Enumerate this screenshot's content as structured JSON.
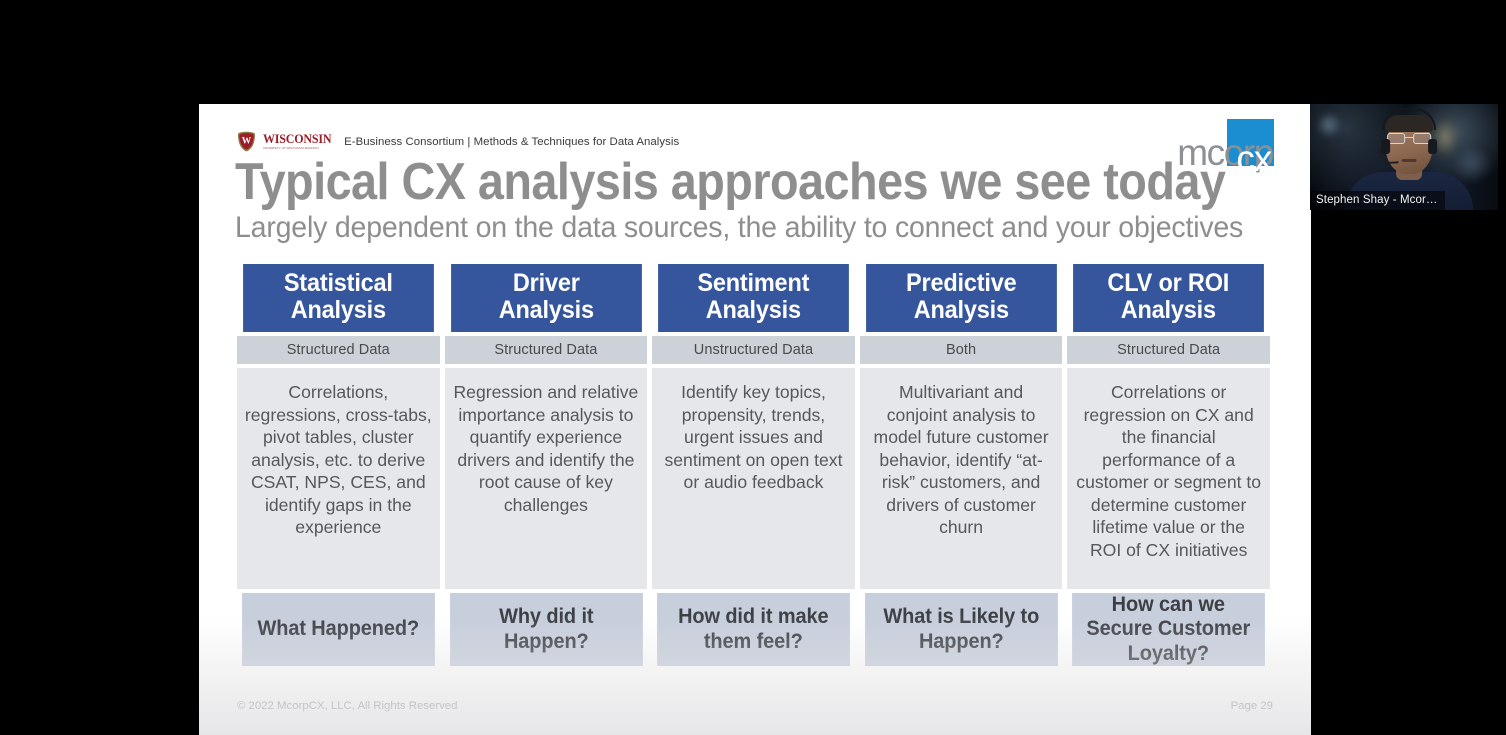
{
  "slide": {
    "brand": {
      "university_name": "WISCONSIN",
      "university_tagline": "UNIVERSITY OF WISCONSIN-MADISON",
      "consortium_text": "E-Business Consortium  |  Methods & Techniques for Data Analysis",
      "company_logo_word": "mcorp",
      "company_logo_accent": "cx",
      "company_accent_color": "#1b8ed2"
    },
    "title": "Typical CX analysis approaches we see today",
    "subtitle": "Largely dependent on the data sources, the ability to connect and your objectives",
    "table": {
      "header_color": "#35569c",
      "subheader_color": "#cdd1d8",
      "body_color": "#e6e7eb",
      "question_color": "#c7cedc",
      "columns": [
        {
          "header_line1": "Statistical",
          "header_line2": "Analysis",
          "data_type": "Structured Data",
          "description": "Correlations, regressions, cross-tabs, pivot tables, cluster analysis, etc. to derive CSAT, NPS, CES, and identify gaps in the experience",
          "question": "What Happened?"
        },
        {
          "header_line1": "Driver",
          "header_line2": "Analysis",
          "data_type": "Structured Data",
          "description": "Regression and relative importance analysis to quantify experience drivers and identify the root cause of key challenges",
          "question": "Why did it Happen?"
        },
        {
          "header_line1": "Sentiment",
          "header_line2": "Analysis",
          "data_type": "Unstructured Data",
          "description": "Identify key topics, propensity, trends, urgent issues and sentiment on open text or audio feedback",
          "question": "How did it make them feel?"
        },
        {
          "header_line1": "Predictive",
          "header_line2": "Analysis",
          "data_type": "Both",
          "description": "Multivariant and conjoint analysis to model future customer behavior, identify “at-risk” customers, and drivers of customer churn",
          "question": "What is Likely to Happen?"
        },
        {
          "header_line1": "CLV or ROI",
          "header_line2": "Analysis",
          "data_type": "Structured Data",
          "description": "Correlations or regression on CX and the financial performance of a customer or segment to determine customer lifetime value or the ROI of CX initiatives",
          "question": "How can we Secure Customer Loyalty?"
        }
      ]
    },
    "footer": {
      "copyright": "© 2022 McorpCX, LLC, All Rights Reserved",
      "page_label": "Page 29"
    }
  },
  "video_tile": {
    "participant_name": "Stephen Shay - Mcor…"
  }
}
